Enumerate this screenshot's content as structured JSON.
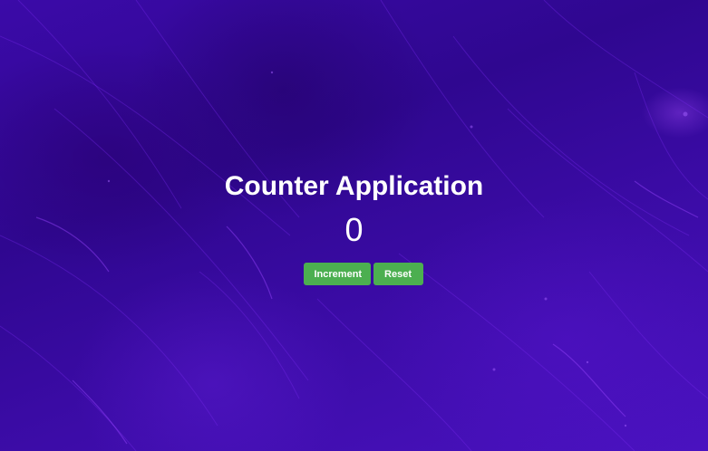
{
  "app": {
    "title": "Counter Application",
    "count": "0"
  },
  "buttons": {
    "increment_label": "Increment",
    "reset_label": "Reset"
  },
  "colors": {
    "background": "#3a0a9e",
    "button": "#4caf50",
    "text": "#ffffff"
  }
}
